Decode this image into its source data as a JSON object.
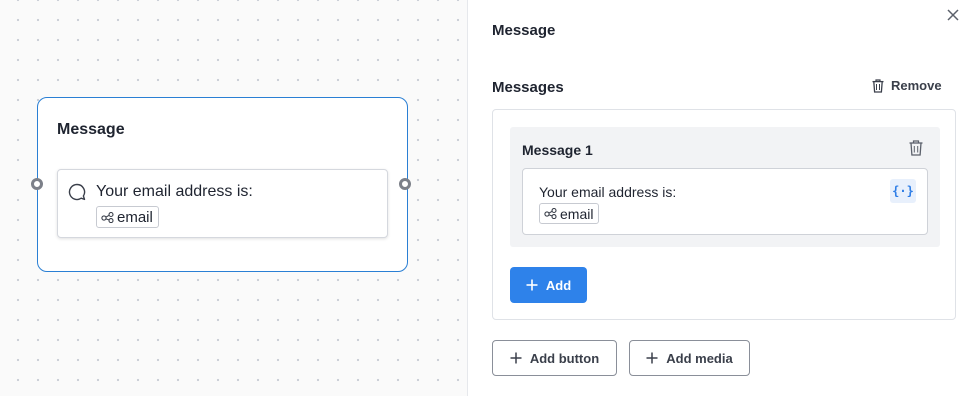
{
  "canvas": {
    "node": {
      "title": "Message",
      "message_text": "Your email address is:",
      "variable": "email"
    }
  },
  "panel": {
    "title": "Message",
    "section_title": "Messages",
    "remove_label": "Remove",
    "messages": [
      {
        "label": "Message 1",
        "text": "Your email address is:",
        "variable": "email"
      }
    ],
    "variable_button_label": "{·}",
    "add_label": "Add",
    "add_button_label": "Add button",
    "add_media_label": "Add media"
  },
  "colors": {
    "accent": "#2e82ea",
    "node_border": "#2a7fd4",
    "variable_icon": "#2f7ee6"
  },
  "icons": [
    "close-icon",
    "chat-bubble-icon",
    "variable-node-icon",
    "trash-icon",
    "variable-insert-icon",
    "plus-icon"
  ]
}
